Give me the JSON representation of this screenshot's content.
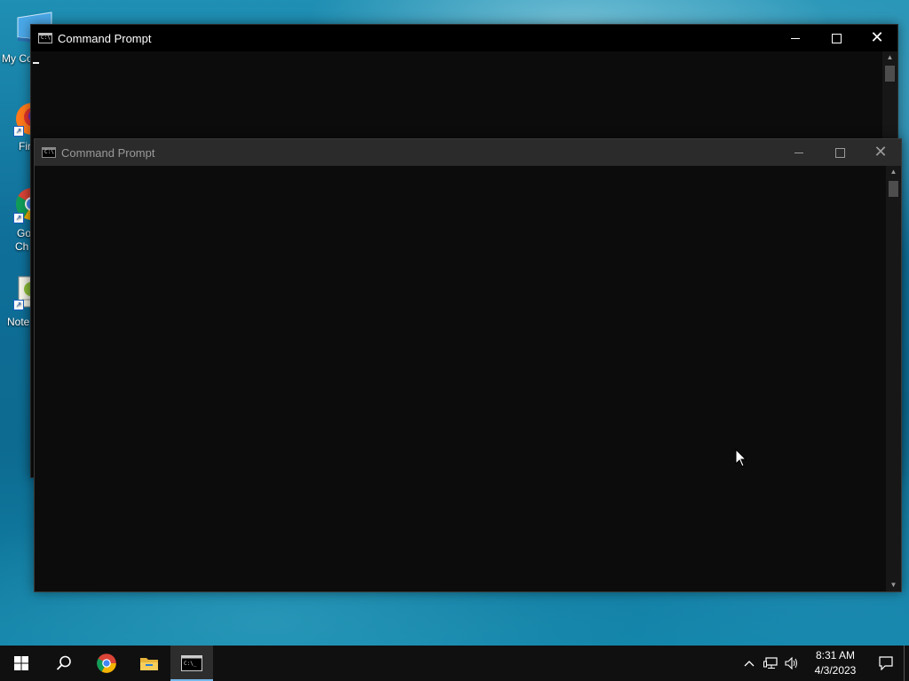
{
  "desktop": {
    "icons": [
      {
        "label": "My Co",
        "icon": "computer-icon"
      },
      {
        "label": "Fir",
        "icon": "firefox-icon"
      },
      {
        "label": "Go",
        "label2": "Ch",
        "icon": "chrome-icon"
      },
      {
        "label": "Note",
        "icon": "notepad-icon"
      }
    ]
  },
  "windows": [
    {
      "title": "Command Prompt",
      "state": "background",
      "icon_text": "C:\\"
    },
    {
      "title": "Command Prompt",
      "state": "foreground",
      "icon_text": "C:\\"
    }
  ],
  "taskbar": {
    "buttons": [
      {
        "name": "start-button",
        "icon": "windows-logo-icon"
      },
      {
        "name": "search-button",
        "icon": "search-icon"
      },
      {
        "name": "chrome-taskbar-button",
        "icon": "chrome-icon"
      },
      {
        "name": "file-explorer-taskbar-button",
        "icon": "folder-icon"
      },
      {
        "name": "cmd-taskbar-button",
        "icon": "cmd-icon",
        "active": true
      }
    ],
    "tray": {
      "icons": [
        "chevron-up-icon",
        "network-icon",
        "volume-icon"
      ],
      "time": "8:31 AM",
      "date": "4/3/2023"
    }
  },
  "colors": {
    "taskbar_bg": "#101010",
    "console_bg": "#0c0c0c",
    "active_indicator": "#76b9ed"
  }
}
